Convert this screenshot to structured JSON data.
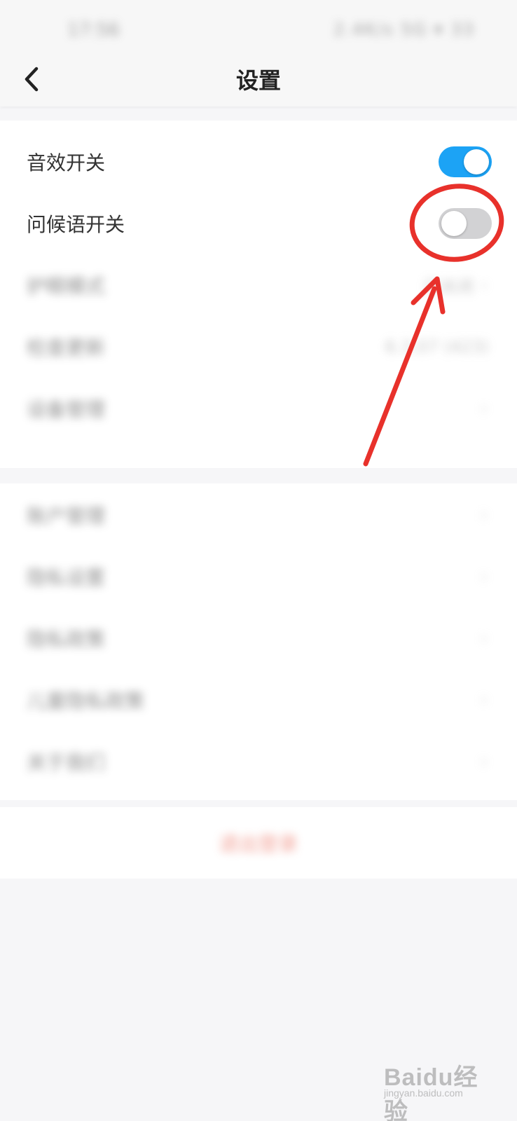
{
  "status_bar": {
    "time": "17:56",
    "right": "2.4K/s 5G ▾ 33"
  },
  "nav": {
    "title": "设置"
  },
  "group1": [
    {
      "label": "音效开关",
      "toggle": "on"
    },
    {
      "label": "问候语开关",
      "toggle": "off"
    },
    {
      "label": "护眼模式",
      "value": "已关闭"
    },
    {
      "label": "检查更新",
      "value": "6.3.07 (423)"
    },
    {
      "label": "设备管理"
    }
  ],
  "group2": [
    {
      "label": "账户管理"
    },
    {
      "label": "隐私设置"
    },
    {
      "label": "隐私政策"
    },
    {
      "label": "儿童隐私政策"
    },
    {
      "label": "关于我们"
    }
  ],
  "logout_label": "退出登录",
  "colors": {
    "toggle_on": "#1ca3f5",
    "toggle_off": "#d2d2d4",
    "annotation": "#e8312b",
    "logout": "#e8533f"
  },
  "watermark": {
    "main": "Baidu经验",
    "sub": "jingyan.baidu.com"
  }
}
